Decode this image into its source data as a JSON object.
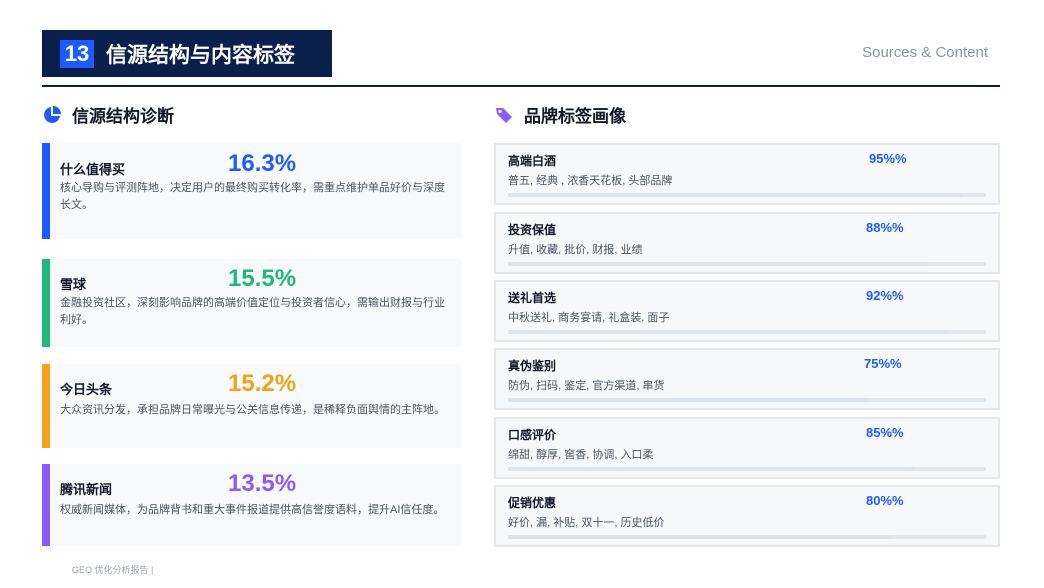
{
  "header": {
    "number": "13",
    "title": "信源结构与内容标签",
    "subtitle_en": "Sources & Content"
  },
  "left_section": {
    "title": "信源结构诊断",
    "icon": "pie-chart-icon",
    "sources": [
      {
        "name": "什么值得买",
        "percent": "16.3%",
        "desc": "核心导购与评测阵地，决定用户的最终购买转化率，需重点维护单品好价与深度长文。",
        "color": "#1d5cff"
      },
      {
        "name": "雪球",
        "percent": "15.5%",
        "desc": "金融投资社区，深刻影响品牌的高端价值定位与投资者信心，需输出财报与行业利好。",
        "color": "#1fb97e"
      },
      {
        "name": "今日头条",
        "percent": "15.2%",
        "desc": "大众资讯分发，承担品牌日常曝光与公关信息传递，是稀释负面舆情的主阵地。",
        "color": "#f5a11c"
      },
      {
        "name": "腾讯新闻",
        "percent": "13.5%",
        "desc": "权威新闻媒体，为品牌背书和重大事件报道提供高信誉度语料，提升AI信任度。",
        "color": "#8b5cf6"
      }
    ]
  },
  "right_section": {
    "title": "品牌标签画像",
    "icon": "tag-icon",
    "icon_color": "#8b5cf6",
    "tags": [
      {
        "name": "高端白酒",
        "percent": "95%%",
        "value": 95,
        "keywords": "普五, 经典      , 浓香天花板, 头部品牌"
      },
      {
        "name": "投资保值",
        "percent": "88%%",
        "value": 88,
        "keywords": "升值, 收藏, 批价, 财报, 业绩"
      },
      {
        "name": "送礼首选",
        "percent": "92%%",
        "value": 92,
        "keywords": "中秋送礼, 商务宴请, 礼盒装, 面子"
      },
      {
        "name": "真伪鉴别",
        "percent": "75%%",
        "value": 75,
        "keywords": "防伪, 扫码, 鉴定, 官方渠道, 串货"
      },
      {
        "name": "口感评价",
        "percent": "85%%",
        "value": 85,
        "keywords": "绵甜, 醇厚, 窖香, 协调, 入口柔"
      },
      {
        "name": "促销优惠",
        "percent": "80%%",
        "value": 80,
        "keywords": "好价, 漏, 补贴, 双十一, 历史低价"
      }
    ]
  },
  "footer": {
    "text": "GEO 优化分析报告 |"
  }
}
